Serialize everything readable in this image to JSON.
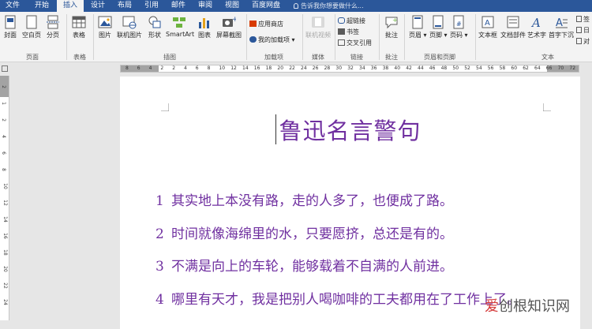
{
  "tabs": [
    "文件",
    "开始",
    "插入",
    "设计",
    "布局",
    "引用",
    "邮件",
    "审阅",
    "视图",
    "百度网盘"
  ],
  "active_tab": "插入",
  "tell_me": "告诉我你想要做什么...",
  "ribbon": {
    "pages": {
      "cover": "封面",
      "blank": "空白页",
      "break": "分页",
      "group": "页面"
    },
    "tables": {
      "table": "表格",
      "group": "表格"
    },
    "illustrations": {
      "picture": "图片",
      "online_picture": "联机图片",
      "shapes": "形状",
      "smartart": "SmartArt",
      "chart": "图表",
      "screenshot": "屏幕截图",
      "group": "插图"
    },
    "addins": {
      "store": "应用商店",
      "my_addins": "我的加载项",
      "group": "加载项"
    },
    "media": {
      "online_video": "联机视频",
      "group": "媒体"
    },
    "links": {
      "hyperlink": "超链接",
      "bookmark": "书签",
      "crossref": "交叉引用",
      "group": "链接"
    },
    "comments": {
      "comment": "批注",
      "group": "批注"
    },
    "header_footer": {
      "header": "页眉",
      "footer": "页脚",
      "page_number": "页码",
      "group": "页眉和页脚"
    },
    "text": {
      "textbox": "文本框",
      "quickparts": "文档部件",
      "wordart": "艺术字",
      "dropcap": "首字下沉",
      "group": "文本"
    },
    "overflow": {
      "a": "签",
      "b": "日",
      "c": "对"
    }
  },
  "ruler_numbers": [
    "8",
    "6",
    "4",
    "2",
    "2",
    "4",
    "6",
    "8",
    "10",
    "12",
    "14",
    "16",
    "18",
    "20",
    "22",
    "24",
    "26",
    "28",
    "30",
    "32",
    "34",
    "36",
    "38",
    "40",
    "42",
    "44",
    "46",
    "48",
    "50",
    "52",
    "54",
    "56",
    "58",
    "60",
    "62",
    "64",
    "66",
    "70",
    "72"
  ],
  "vruler_numbers": [
    "2",
    "1",
    "2",
    "4",
    "6",
    "8",
    "10",
    "12",
    "14",
    "16",
    "18",
    "20",
    "22",
    "24"
  ],
  "document": {
    "title": "鲁迅名言警句",
    "lines": [
      {
        "num": "1",
        "text": "其实地上本没有路，走的人多了，也便成了路。"
      },
      {
        "num": "2",
        "text": "时间就像海绵里的水，只要愿挤，总还是有的。"
      },
      {
        "num": "3",
        "text": "不满是向上的车轮，能够载着不自满的人前进。"
      },
      {
        "num": "4",
        "text": "哪里有天才，我是把别人喝咖啡的工夫都用在了工作上了。"
      }
    ]
  },
  "watermark": {
    "highlight": "爱",
    "rest": "创根知识网"
  },
  "colors": {
    "accent": "#2b579a",
    "text_purple": "#7030a0"
  }
}
